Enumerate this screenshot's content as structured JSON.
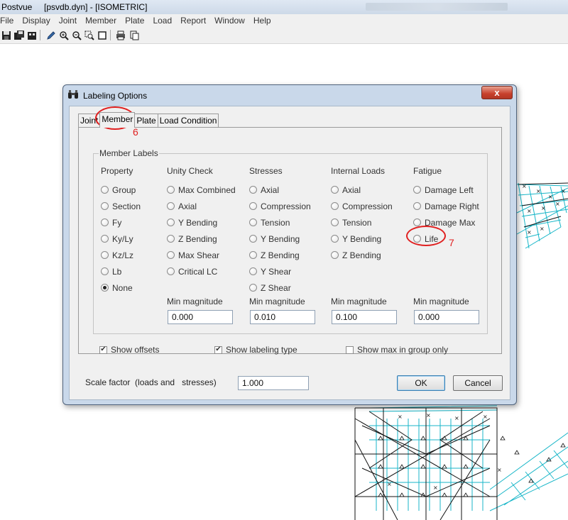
{
  "app": {
    "title_app": "Postvue",
    "title_doc": "[psvdb.dyn] - [ISOMETRIC]"
  },
  "menu": [
    "File",
    "Display",
    "Joint",
    "Member",
    "Plate",
    "Load",
    "Report",
    "Window",
    "Help"
  ],
  "toolbar_icons": [
    "save-icon",
    "save-all-icon",
    "print-preview-icon",
    "pencil-icon",
    "zoom-in-icon",
    "zoom-out-icon",
    "zoom-window-icon",
    "window-icon",
    "print-icon",
    "copy-icon"
  ],
  "dialog": {
    "title": "Labeling Options",
    "tabs": [
      "Joint",
      "Member",
      "Plate",
      "Load Condition"
    ],
    "active_tab": "Member",
    "group_label": "Member Labels",
    "columns": {
      "property": {
        "title": "Property",
        "options": [
          "Group",
          "Section",
          "Fy",
          "Ky/Ly",
          "Kz/Lz",
          "Lb",
          "None"
        ],
        "selected": "None"
      },
      "unity": {
        "title": "Unity Check",
        "options": [
          "Max Combined",
          "Axial",
          "Y Bending",
          "Z Bending",
          "Max Shear",
          "Critical LC"
        ],
        "min_label": "Min magnitude",
        "min_value": "0.000"
      },
      "stresses": {
        "title": "Stresses",
        "options": [
          "Axial",
          "Compression",
          "Tension",
          "Y Bending",
          "Z Bending",
          "Y Shear",
          "Z Shear"
        ],
        "min_label": "Min magnitude",
        "min_value": "0.010"
      },
      "internal": {
        "title": "Internal Loads",
        "options": [
          "Axial",
          "Compression",
          "Tension",
          "Y Bending",
          "Z Bending"
        ],
        "min_label": "Min magnitude",
        "min_value": "0.100"
      },
      "fatigue": {
        "title": "Fatigue",
        "options": [
          "Damage Left",
          "Damage Right",
          "Damage Max",
          "Life"
        ],
        "min_label": "Min magnitude",
        "min_value": "0.000"
      }
    },
    "checks": [
      {
        "label": "Show offsets",
        "checked": true
      },
      {
        "label": "Show labeling type",
        "checked": true
      },
      {
        "label": "Show max in group only",
        "checked": false
      }
    ],
    "scale_label": "Scale factor  (loads and   stresses)",
    "scale_value": "1.000",
    "ok_label": "OK",
    "cancel_label": "Cancel",
    "close_glyph": "x"
  },
  "annotations": [
    "6",
    "7"
  ]
}
